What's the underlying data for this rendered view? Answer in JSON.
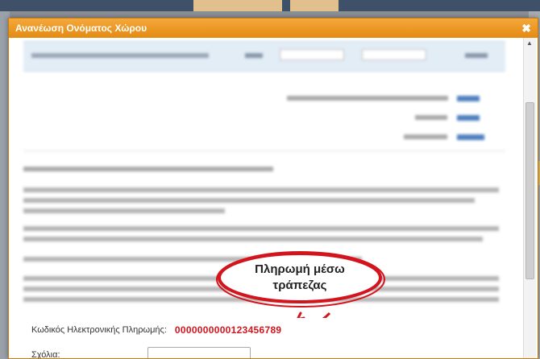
{
  "dialog": {
    "title": "Ανανέωση Ονόματος Χώρου",
    "close_icon": "close-icon"
  },
  "callout": {
    "line1": "Πληρωμή μέσω",
    "line2": "τράπεζας",
    "color": "#d4141c"
  },
  "payment": {
    "code_label": "Κωδικός Ηλεκτρονικής Πληρωμής:",
    "code_value": "0000000000123456789"
  },
  "comments": {
    "label": "Σχόλια:",
    "value": ""
  },
  "colors": {
    "titlebar": "#e8901a",
    "accent_red": "#d4141c"
  }
}
